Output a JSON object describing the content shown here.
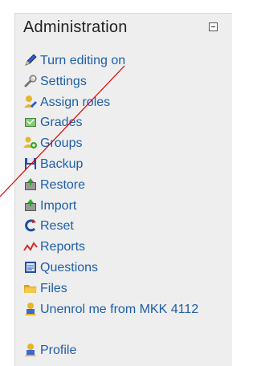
{
  "block": {
    "title": "Administration",
    "items": [
      {
        "label": "Turn editing on",
        "icon": "pencil-icon"
      },
      {
        "label": "Settings",
        "icon": "wrench-icon"
      },
      {
        "label": "Assign roles",
        "icon": "assign-roles-icon"
      },
      {
        "label": "Grades",
        "icon": "grades-icon"
      },
      {
        "label": "Groups",
        "icon": "groups-icon"
      },
      {
        "label": "Backup",
        "icon": "backup-icon"
      },
      {
        "label": "Restore",
        "icon": "restore-icon"
      },
      {
        "label": "Import",
        "icon": "import-icon"
      },
      {
        "label": "Reset",
        "icon": "reset-icon"
      },
      {
        "label": "Reports",
        "icon": "reports-icon"
      },
      {
        "label": "Questions",
        "icon": "questions-icon"
      },
      {
        "label": "Files",
        "icon": "folder-icon"
      },
      {
        "label": "Unenrol me from MKK 4112",
        "icon": "user-icon"
      },
      {
        "label": "Profile",
        "icon": "user-icon"
      }
    ]
  },
  "colors": {
    "link": "#1e5ea8",
    "block_bg": "#eeeeee",
    "annotation_line": "#e00000"
  }
}
